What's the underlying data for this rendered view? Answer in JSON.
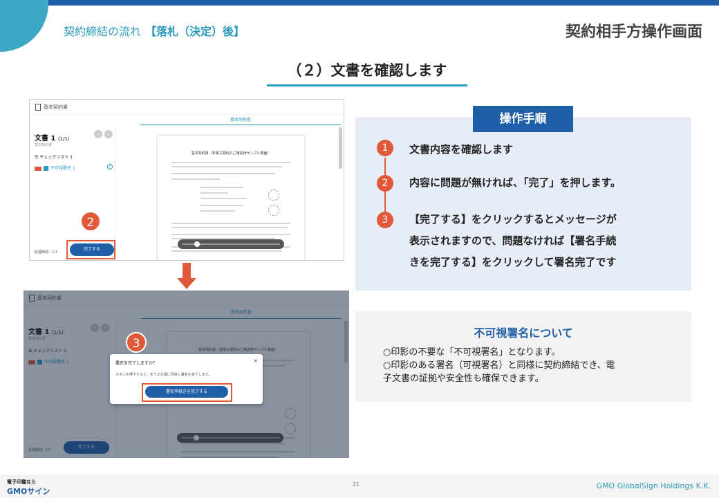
{
  "header": {
    "breadcrumb_prefix": "契約締結の流れ",
    "breadcrumb_highlight": "【落札（決定）後】",
    "right_title": "契約相手方操作画面"
  },
  "slide": {
    "title": "（２）文書を確認します"
  },
  "screenshot_app": {
    "window_title": "基本契約書",
    "center_tab": "基本契約書",
    "doc_name": "文書 1",
    "doc_count": "(1/1)",
    "doc_sub": "基本契約書",
    "checklist_title": "チェックリスト 1",
    "checklist_item": "不可視署名 1",
    "help_glyph": "?",
    "status": "処理時間：1/1",
    "complete_button": "完了する",
    "paper_title": "基本契約書（非電子契約のご確認用サンプル書面）",
    "zoom_minus": "−",
    "zoom_plus": "+",
    "nav_prev": "‹",
    "nav_next": "›",
    "modal_title": "署名を完了しますか？",
    "modal_body": "ボタンを押下すると、全ての文書に同意し署名を完了します。",
    "modal_button": "署名手続きを完了する",
    "modal_close": "×"
  },
  "markers": {
    "m2": "2",
    "m3": "3"
  },
  "steps_panel": {
    "tag": "操作手順",
    "steps": [
      {
        "num": "1",
        "lines": [
          "文書内容を確認します"
        ]
      },
      {
        "num": "2",
        "lines": [
          "内容に問題が無ければ、「完了」を押します。"
        ]
      },
      {
        "num": "3",
        "lines": [
          "【完了する】をクリックするとメッセージが",
          "表示されますので、問題なければ【署名手続",
          "きを完了する】をクリックして署名完了です"
        ]
      }
    ]
  },
  "info_panel": {
    "title": "不可視署名について",
    "lines": [
      "○印影の不要な「不可視署名」となります。",
      "○印影のある署名（可視署名）と同様に契約締結でき、電",
      "子文書の証拠や安全性も確保できます。"
    ]
  },
  "footer": {
    "logo_sub": "電子印鑑なら",
    "logo": "GMOサイン",
    "page_number": "21",
    "company": "GMO GlobalSign Holdings K.K."
  },
  "colors": {
    "brand": "#1f5fa8",
    "accent": "#2a9bbf",
    "alert": "#e05a3a"
  }
}
